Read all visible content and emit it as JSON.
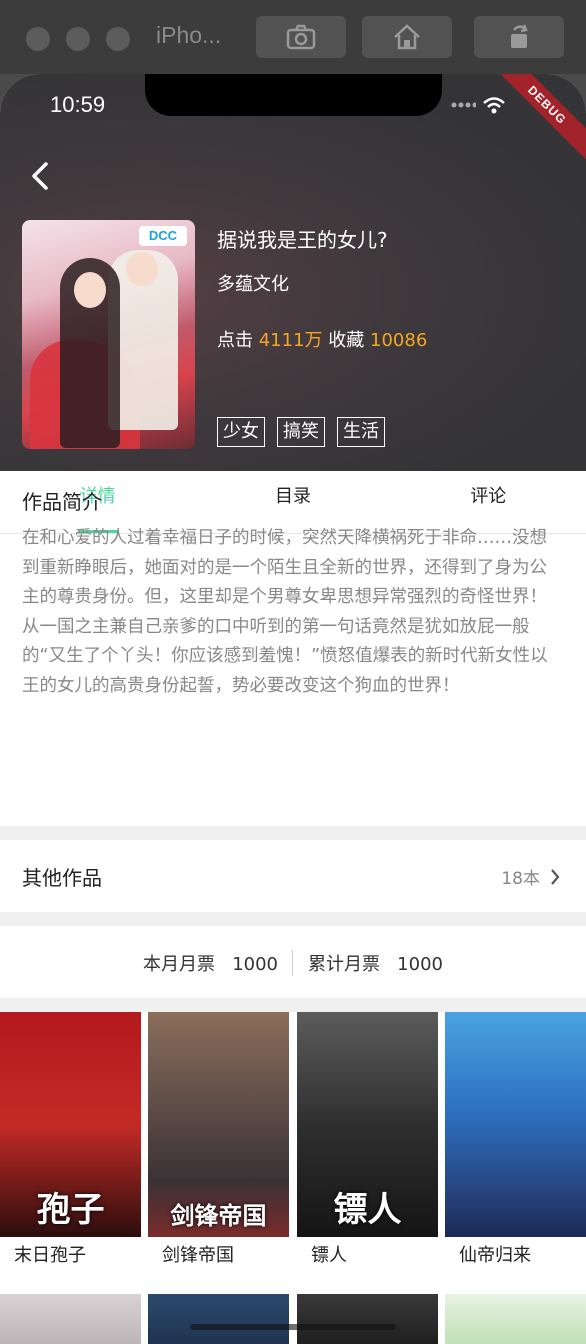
{
  "sim": {
    "title": "iPho..."
  },
  "status": {
    "time": "10:59",
    "debug": "DEBUG"
  },
  "book": {
    "title": "据说我是王的女儿?",
    "author": "多蕴文化",
    "clicks_label": "点击",
    "clicks": "4111万",
    "favs_label": "收藏",
    "favs": "10086",
    "tags": [
      "少女",
      "搞笑",
      "生活"
    ],
    "cover_logo": "DCC"
  },
  "tabs": [
    "详情",
    "目录",
    "评论"
  ],
  "intro": {
    "heading": "作品简介",
    "text": "在和心爱的人过着幸福日子的时候，突然天降横祸死于非命……没想到重新睁眼后，她面对的是一个陌生且全新的世界，还得到了身为公主的尊贵身份。但，这里却是个男尊女卑思想异常强烈的奇怪世界！从一国之主兼自己亲爹的口中听到的第一句话竟然是犹如放屁一般的“又生了个丫头！你应该感到羞愧！”愤怒值爆表的新时代新女性以王的女儿的高贵身份起誓，势必要改变这个狗血的世界！"
  },
  "other_works": {
    "label": "其他作品",
    "count": "18本"
  },
  "votes": {
    "month_label": "本月月票",
    "month": "1000",
    "total_label": "累计月票",
    "total": "1000"
  },
  "works": [
    {
      "name": "末日孢子",
      "overlay": "孢子"
    },
    {
      "name": "剑锋帝国",
      "overlay": "剑锋帝国"
    },
    {
      "name": "镖人",
      "overlay": "镖人"
    },
    {
      "name": "仙帝归来",
      "overlay": ""
    }
  ],
  "colors": {
    "accent": "#4cd6a0",
    "highlight": "#f5a623"
  }
}
